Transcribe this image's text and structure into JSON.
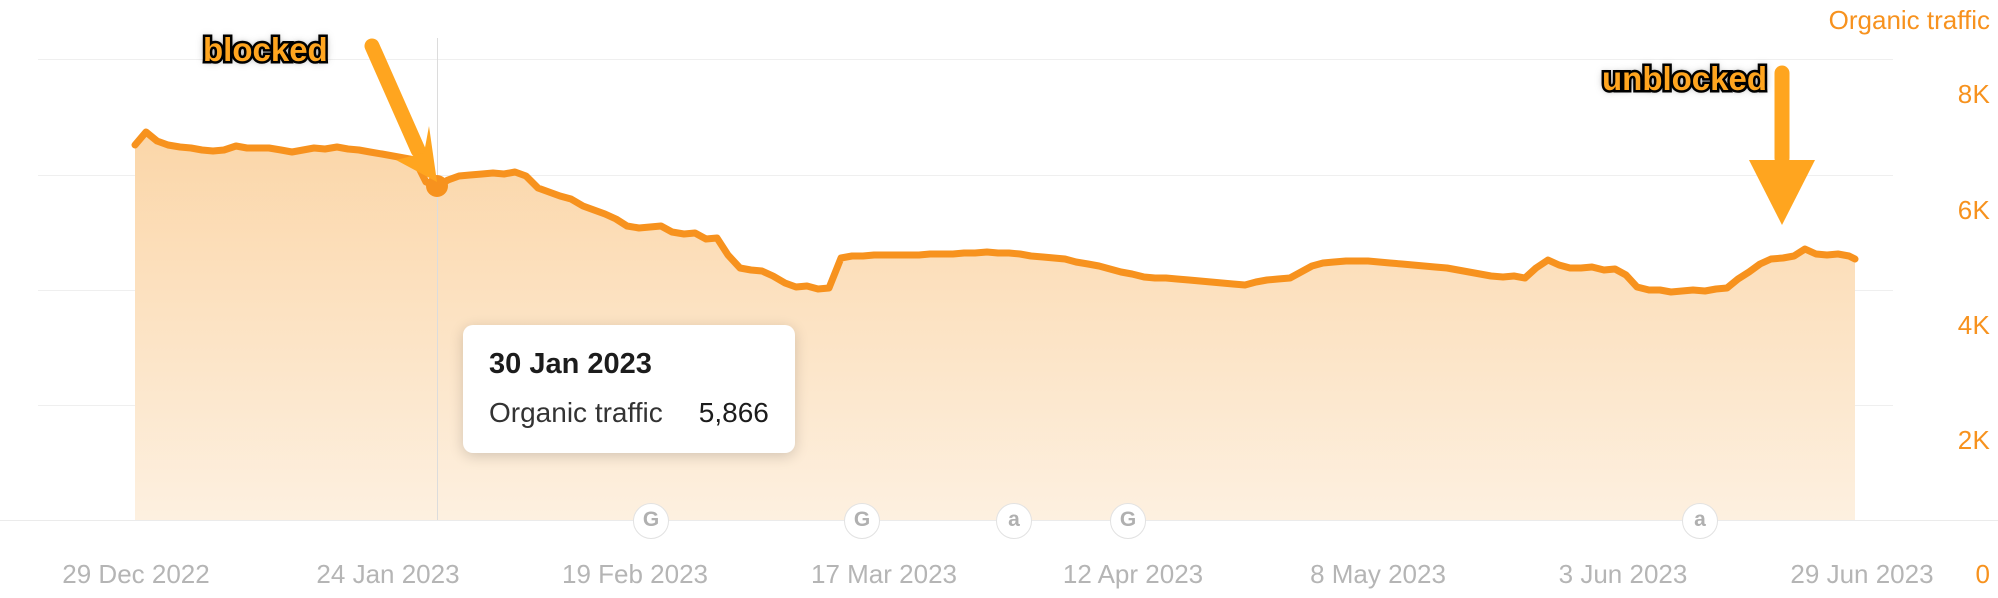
{
  "chart_data": {
    "type": "area",
    "title": "",
    "xlabel": "",
    "ylabel": "Organic traffic",
    "ylim": [
      0,
      9000
    ],
    "grid": true,
    "legend_position": "top-right",
    "series_color": "#f7921e",
    "fill_color": "#fbdcb6",
    "y_ticks": [
      "8K",
      "6K",
      "4K",
      "2K",
      "0"
    ],
    "y_tick_values": [
      8000,
      6000,
      4000,
      2000,
      0
    ],
    "x_ticks": [
      "29 Dec 2022",
      "24 Jan 2023",
      "19 Feb 2023",
      "17 Mar 2023",
      "12 Apr 2023",
      "8 May 2023",
      "3 Jun 2023",
      "29 Jun 2023"
    ],
    "series": [
      {
        "name": "Organic traffic",
        "x": [
          "29 Dec 2022",
          "02 Jan 2023",
          "05 Jan 2023",
          "08 Jan 2023",
          "11 Jan 2023",
          "14 Jan 2023",
          "17 Jan 2023",
          "20 Jan 2023",
          "24 Jan 2023",
          "27 Jan 2023",
          "30 Jan 2023",
          "02 Feb 2023",
          "05 Feb 2023",
          "08 Feb 2023",
          "11 Feb 2023",
          "14 Feb 2023",
          "19 Feb 2023",
          "22 Feb 2023",
          "25 Feb 2023",
          "28 Feb 2023",
          "03 Mar 2023",
          "06 Mar 2023",
          "09 Mar 2023",
          "12 Mar 2023",
          "17 Mar 2023",
          "21 Mar 2023",
          "25 Mar 2023",
          "29 Mar 2023",
          "02 Apr 2023",
          "06 Apr 2023",
          "12 Apr 2023",
          "16 Apr 2023",
          "20 Apr 2023",
          "24 Apr 2023",
          "28 Apr 2023",
          "02 May 2023",
          "08 May 2023",
          "12 May 2023",
          "16 May 2023",
          "20 May 2023",
          "24 May 2023",
          "28 May 2023",
          "03 Jun 2023",
          "07 Jun 2023",
          "11 Jun 2023",
          "15 Jun 2023",
          "19 Jun 2023",
          "23 Jun 2023",
          "26 Jun 2023",
          "29 Jun 2023"
        ],
        "values": [
          6520,
          6640,
          6440,
          6390,
          6370,
          6350,
          6330,
          6390,
          6360,
          6420,
          5866,
          6380,
          6300,
          6130,
          5940,
          5820,
          5700,
          5760,
          5740,
          5300,
          5140,
          5110,
          5070,
          4950,
          4960,
          4940,
          4930,
          4920,
          4880,
          4870,
          4860,
          4790,
          4770,
          4830,
          4840,
          4860,
          5010,
          4970,
          4930,
          4890,
          4950,
          4890,
          4790,
          4740,
          4740,
          4750,
          4760,
          5280,
          5420,
          5240
        ]
      }
    ],
    "hover_point": {
      "date": "30 Jan 2023",
      "metric": "Organic traffic",
      "value": "5,866"
    },
    "annotations": [
      {
        "label": "blocked",
        "kind": "arrow-down-right",
        "target_date": "30 Jan 2023"
      },
      {
        "label": "unblocked",
        "kind": "arrow-down",
        "target_date": "23 Jun 2023"
      }
    ],
    "event_markers": [
      {
        "icon": "google-update-icon",
        "glyph": "G",
        "x_date": "19 Feb 2023"
      },
      {
        "icon": "google-update-icon",
        "glyph": "G",
        "x_date": "17 Mar 2023"
      },
      {
        "icon": "ahrefs-event-icon",
        "glyph": "a",
        "x_date": "28 Mar 2023"
      },
      {
        "icon": "google-update-icon",
        "glyph": "G",
        "x_date": "12 Apr 2023"
      },
      {
        "icon": "ahrefs-event-icon",
        "glyph": "a",
        "x_date": "3 Jun 2023"
      }
    ]
  },
  "tooltip": {
    "date": "30 Jan 2023",
    "metric_label": "Organic traffic",
    "metric_value": "5,866"
  },
  "axis": {
    "y_title": "Organic traffic",
    "y_labels": [
      "8K",
      "6K",
      "4K",
      "2K"
    ],
    "zero_label": "0",
    "x_labels": [
      "29 Dec 2022",
      "24 Jan 2023",
      "19 Feb 2023",
      "17 Mar 2023",
      "12 Apr 2023",
      "8 May 2023",
      "3 Jun 2023",
      "29 Jun 2023"
    ]
  },
  "annotations": {
    "blocked_label": "blocked",
    "unblocked_label": "unblocked"
  },
  "markers": {
    "google_glyph": "G",
    "ahrefs_glyph": "a"
  },
  "colors": {
    "accent": "#f7921e",
    "annotation": "#ffa51f",
    "area_fill": "#fbdcb6",
    "grid": "#efefef",
    "axis_text": "#b5b5b5"
  }
}
